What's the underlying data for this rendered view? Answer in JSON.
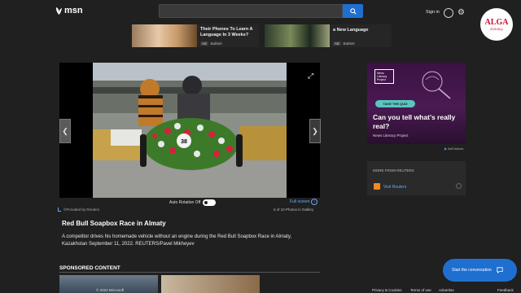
{
  "header": {
    "logo_text": "msn",
    "signin_label": "Sign in",
    "alga_title": "ALGA",
    "alga_subtitle": "Holiday"
  },
  "top_ads": [
    {
      "title_line1": "Their Phones To Learn A",
      "title_line2": "Language In 3 Weeks?",
      "ad_badge": "Ad",
      "sponsor": "Babbel"
    },
    {
      "title_line1": "a New Language",
      "ad_badge": "Ad",
      "sponsor": "Babbel"
    }
  ],
  "gallery": {
    "provided_by": "©Provided by Reuters",
    "autorotate_label": "Auto Rotation Off",
    "fullscreen_label": "Full screen",
    "counter": "6 of 10 Photos in Gallery",
    "number_plate": "38"
  },
  "caption": {
    "title": "Red Bull Soapbox Race in Almaty",
    "text": "A competitor drives his homemade vehicle without an engine during the Red Bull Soapbox Race in Almaty, Kazakhstan September 11, 2022. REUTERS/Pavel Mikheyev"
  },
  "sponsored": {
    "heading": "SPONSORED CONTENT"
  },
  "right_ad": {
    "logo_text": "News Literacy Project",
    "button_label": "TAKE THE QUIZ",
    "question": "Can you tell what’s really real?",
    "sponsor": "News Literacy Project",
    "adchoices": "AdChoices"
  },
  "reuters_panel": {
    "heading": "MORE FROM REUTERS",
    "visit_label": "Visit Reuters"
  },
  "chat": {
    "label": "Start the conversation"
  },
  "footer": {
    "copyright": "© 2022 Microsoft",
    "privacy": "Privacy & Cookies",
    "terms": "Terms of use",
    "advertise": "Advertise",
    "feedback": "Feedback"
  },
  "colors": {
    "background": "#202020",
    "accent_blue": "#1f6fd0",
    "link_blue": "#6aa8ff",
    "ad_purple": "#4a1a52",
    "quiz_teal": "#5bc6c0"
  }
}
